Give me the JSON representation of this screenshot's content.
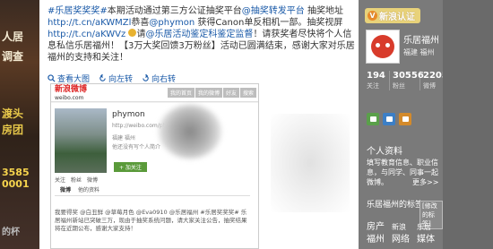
{
  "left_art": {
    "lines": [
      "人居",
      "调查",
      "渡头",
      "房团",
      "3585",
      "0001",
      "的杯"
    ]
  },
  "post": {
    "hashtag": "#乐居奖奖奖#",
    "text1": "本期活动通过第三方公证抽奖平台",
    "hashtag2": "@抽奖转发平台",
    "text2": " 抽奖地址 ",
    "link1": "http://t.cn/aKWMZl",
    "text3": "恭喜",
    "mention1": "@phymon",
    "text4": " 获得Canon单反相机一部。抽奖视屏",
    "link2": "http://t.cn/aKWVz",
    "text5": "请",
    "mention2": "@乐居活动鉴定科鉴定监督",
    "text6": "！请获奖者尽快将个人信息私信乐居福州！【3万大奖回馈3万粉丝】活动已圆满结束，感谢大家对乐居福州的支持和关注！"
  },
  "actions": {
    "view_large": "查看大图",
    "rotate_left": "向左转",
    "rotate_right": "向右转"
  },
  "embedded": {
    "logo": "新浪微博",
    "logo_sub": "weibo.com",
    "nav": [
      "我的首页",
      "我的微博",
      "好友",
      "搜索"
    ],
    "name": "phymon",
    "url": "http://weibo.com/phym",
    "location": "福建 福州",
    "desc": "他还没有写个人简介",
    "follow": "+ 加关注",
    "counts": [
      "关注",
      "粉丝",
      "微博"
    ],
    "tabs": [
      "微博",
      "他的资料"
    ],
    "post_text": "我要得奖 @白丑鲜 @草莓月色 @Eva0910 @乐居福州 #乐居奖奖奖# 乐居福州新站已突破三万，现由于抽奖系统问题，请大家关注公告，抽奖结果将在近期公布，感谢大家支持！"
  },
  "sidebar": {
    "verified_badge": "新浪认证",
    "verified_mark": "V",
    "profile_name": "乐居福州",
    "profile_location": "福建 福州",
    "stats": [
      {
        "num": "194",
        "label": "关注"
      },
      {
        "num": "30556",
        "label": "粉丝"
      },
      {
        "num": "2205",
        "label": "微博"
      }
    ],
    "profile_heading": "个人资料",
    "profile_text": "填写教育信息、职业信息，与同学、同事一起微博。",
    "more": "更多>>",
    "tags_heading": "乐居福州的标签",
    "tags_button": "[修改的标签]",
    "tags": [
      "房产",
      "新浪",
      "乐居",
      "福州",
      "网络",
      "媒体"
    ]
  }
}
